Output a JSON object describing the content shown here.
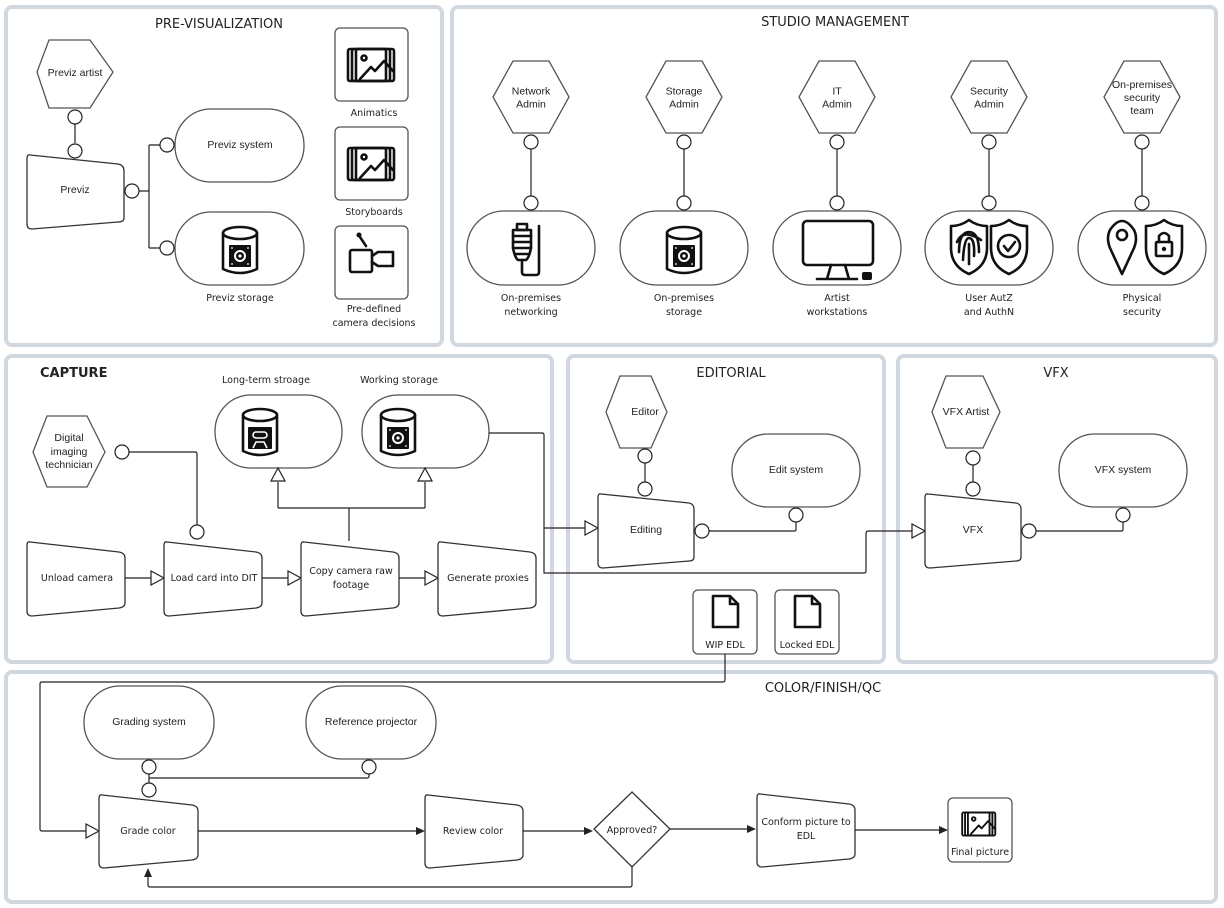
{
  "panels": {
    "previz": {
      "title": "PRE-VISUALIZATION"
    },
    "studio": {
      "title": "STUDIO MANAGEMENT"
    },
    "capture": {
      "title": "CAPTURE"
    },
    "editorial": {
      "title": "EDITORIAL"
    },
    "vfx": {
      "title": "VFX"
    },
    "color": {
      "title": "COLOR/FINISH/QC"
    }
  },
  "previz": {
    "actor": "Previz artist",
    "process": "Previz",
    "system": "Previz system",
    "storage_label": "Previz storage",
    "assets": [
      {
        "label": "Animatics",
        "icon": "image-stack-icon"
      },
      {
        "label": "Storyboards",
        "icon": "image-stack-icon"
      },
      {
        "label_lines": [
          "Pre-defined",
          "camera decisions"
        ],
        "icon": "camera-edit-icon"
      }
    ]
  },
  "studio": {
    "columns": [
      {
        "actor_lines": [
          "Network",
          "Admin"
        ],
        "resource_lines": [
          "On-premises",
          "networking"
        ],
        "icon": "ethernet-cable-icon"
      },
      {
        "actor_lines": [
          "Storage",
          "Admin"
        ],
        "resource_lines": [
          "On-premises",
          "storage"
        ],
        "icon": "storage-disk-icon"
      },
      {
        "actor_lines": [
          "IT",
          "Admin"
        ],
        "resource_lines": [
          "Artist",
          "workstations"
        ],
        "icon": "monitor-icon"
      },
      {
        "actor_lines": [
          "Security",
          "Admin"
        ],
        "resource_lines": [
          "User AutZ",
          "and AuthN"
        ],
        "icon": "fingerprint-shield-icon"
      },
      {
        "actor_lines": [
          "On-premises",
          "security",
          "team"
        ],
        "resource_lines": [
          "Physical",
          "security"
        ],
        "icon": "location-lock-icon"
      }
    ]
  },
  "capture": {
    "actor_lines": [
      "Digital",
      "imaging",
      "technician"
    ],
    "long_term_storage": "Long-term stroage",
    "working_storage": "Working storage",
    "steps": [
      {
        "lines": [
          "Unload camera"
        ]
      },
      {
        "lines": [
          "Load card into DIT"
        ]
      },
      {
        "lines": [
          "Copy camera raw",
          "footage"
        ]
      },
      {
        "lines": [
          "Generate proxies"
        ]
      }
    ]
  },
  "editorial": {
    "actor": "Editor",
    "process": "Editing",
    "system": "Edit system",
    "documents": [
      "WIP EDL",
      "Locked EDL"
    ]
  },
  "vfx": {
    "actor": "VFX Artist",
    "process": "VFX",
    "system": "VFX system"
  },
  "color": {
    "grading_system": "Grading system",
    "reference_projector": "Reference projector",
    "grade": "Grade color",
    "review": "Review color",
    "decision": "Approved?",
    "conform_lines": [
      "Conform picture to",
      "EDL"
    ],
    "final": "Final picture"
  }
}
